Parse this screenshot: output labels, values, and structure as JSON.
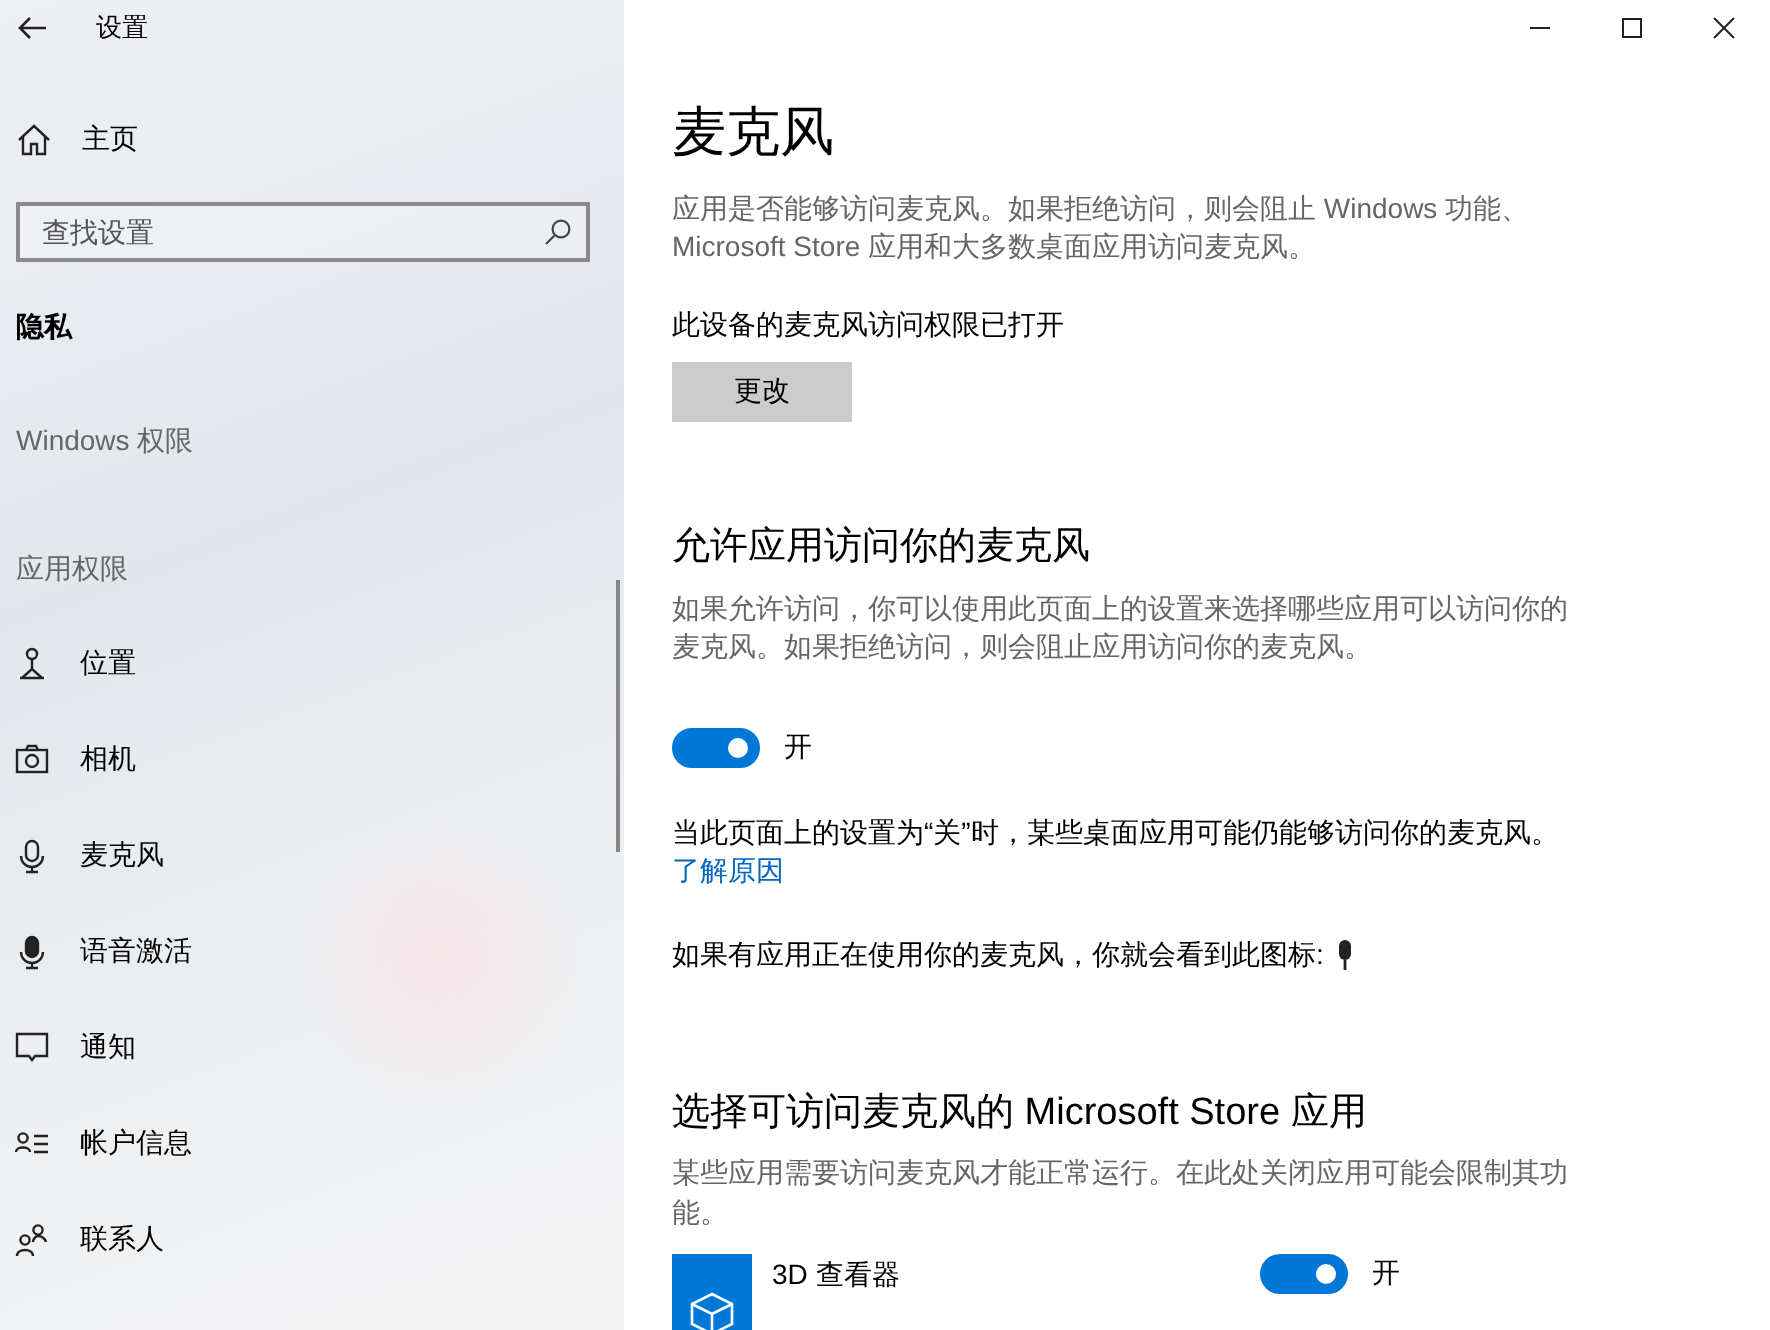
{
  "window": {
    "title": "设置"
  },
  "sidebar": {
    "home": "主页",
    "search": {
      "placeholder": "查找设置"
    },
    "section": "隐私",
    "group_1": "Windows 权限",
    "group_2": "应用权限",
    "items": [
      {
        "label": "位置"
      },
      {
        "label": "相机"
      },
      {
        "label": "麦克风"
      },
      {
        "label": "语音激活"
      },
      {
        "label": "通知"
      },
      {
        "label": "帐户信息"
      },
      {
        "label": "联系人"
      }
    ]
  },
  "page": {
    "title": "麦克风",
    "intro": "应用是否能够访问麦克风。如果拒绝访问，则会阻止 Windows 功能、Microsoft Store 应用和大多数桌面应用访问麦克风。",
    "device_status": "此设备的麦克风访问权限已打开",
    "change_button": "更改",
    "allow_heading": "允许应用访问你的麦克风",
    "allow_description": "如果允许访问，你可以使用此页面上的设置来选择哪些应用可以访问你的麦克风。如果拒绝访问，则会阻止应用访问你的麦克风。",
    "allow_toggle": {
      "on": true,
      "label": "开"
    },
    "note": "当此页面上的设置为“关”时，某些桌面应用可能仍能够访问你的麦克风。",
    "learn_more": "了解原因",
    "icon_hint": "如果有应用正在使用你的麦克风，你就会看到此图标:",
    "store_heading": "选择可访问麦克风的 Microsoft Store 应用",
    "store_description": "某些应用需要访问麦克风才能正常运行。在此处关闭应用可能会限制其功能。",
    "apps": [
      {
        "name": "3D 查看器",
        "on": true,
        "label": "开"
      }
    ]
  }
}
